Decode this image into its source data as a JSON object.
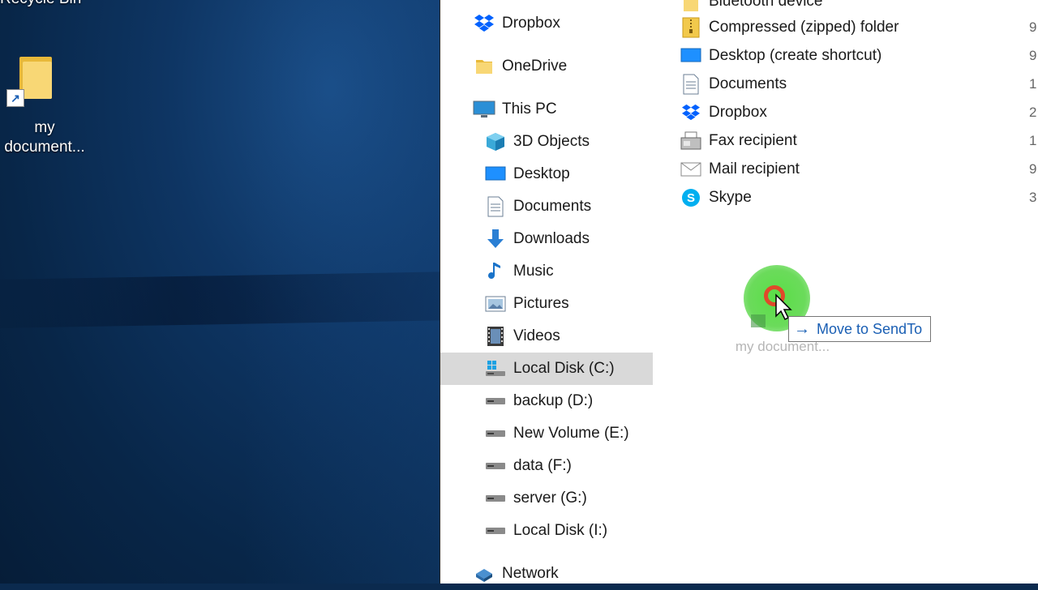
{
  "desktop": {
    "top_partial_label": "Recycle Bin",
    "icon_label": "my document..."
  },
  "nav": {
    "items": [
      {
        "label": "Dropbox",
        "icon": "dropbox-icon"
      },
      {
        "label": "OneDrive",
        "icon": "onedrive-folder-icon"
      },
      {
        "label": "This PC",
        "icon": "this-pc-icon"
      },
      {
        "label": "3D Objects",
        "icon": "3d-objects-icon"
      },
      {
        "label": "Desktop",
        "icon": "desktop-icon"
      },
      {
        "label": "Documents",
        "icon": "documents-icon"
      },
      {
        "label": "Downloads",
        "icon": "downloads-icon"
      },
      {
        "label": "Music",
        "icon": "music-icon"
      },
      {
        "label": "Pictures",
        "icon": "pictures-icon"
      },
      {
        "label": "Videos",
        "icon": "videos-icon"
      },
      {
        "label": "Local Disk (C:)",
        "icon": "windows-drive-icon",
        "selected": true
      },
      {
        "label": "backup (D:)",
        "icon": "drive-icon"
      },
      {
        "label": "New Volume (E:)",
        "icon": "drive-icon"
      },
      {
        "label": "data (F:)",
        "icon": "drive-icon"
      },
      {
        "label": "server (G:)",
        "icon": "drive-icon"
      },
      {
        "label": "Local Disk (I:)",
        "icon": "drive-icon"
      },
      {
        "label": "Network",
        "icon": "network-icon"
      }
    ]
  },
  "content": {
    "items": [
      {
        "label": "Bluetooth device",
        "size": "",
        "icon": "bluetooth-icon"
      },
      {
        "label": "Compressed (zipped) folder",
        "size": "9",
        "icon": "zip-folder-icon"
      },
      {
        "label": "Desktop (create shortcut)",
        "size": "9",
        "icon": "desktop-icon"
      },
      {
        "label": "Documents",
        "size": "1",
        "icon": "documents-icon"
      },
      {
        "label": "Dropbox",
        "size": "2",
        "icon": "dropbox-icon"
      },
      {
        "label": "Fax recipient",
        "size": "1",
        "icon": "fax-icon"
      },
      {
        "label": "Mail recipient",
        "size": "9",
        "icon": "mail-icon"
      },
      {
        "label": "Skype",
        "size": "3",
        "icon": "skype-icon"
      }
    ]
  },
  "drag": {
    "ghost_label": "my document...",
    "tooltip": "Move to SendTo"
  },
  "colors": {
    "selection": "#d9d9d9",
    "tooltip_text": "#1a5fb4",
    "click_halo": "#50dc3c",
    "click_ring": "#e04a2a"
  }
}
